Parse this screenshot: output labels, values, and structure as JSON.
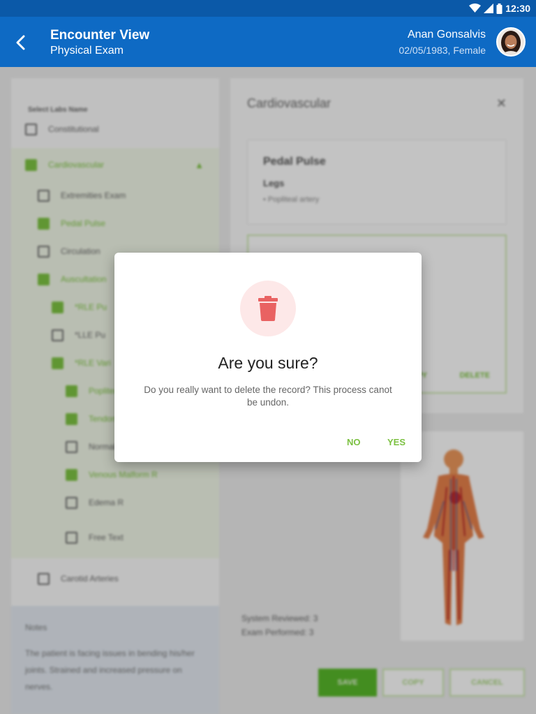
{
  "status_bar": {
    "time": "12:30"
  },
  "header": {
    "title": "Encounter View",
    "subtitle": "Physical Exam",
    "patient_name": "Anan Gonsalvis",
    "patient_meta": "02/05/1983, Female"
  },
  "left_panel": {
    "heading": "Select Labs Name",
    "items": [
      {
        "label": "Constitutional",
        "checked": false
      },
      {
        "label": "Cardiovascular",
        "checked": true
      },
      {
        "label": "Extremities Exam",
        "checked": false
      },
      {
        "label": "Pedal Pulse",
        "checked": true
      },
      {
        "label": "Circulation",
        "checked": false
      },
      {
        "label": "Auscultation",
        "checked": true
      },
      {
        "label": "*RLE Pu",
        "checked": true
      },
      {
        "label": "*LLE Pu",
        "checked": false
      },
      {
        "label": "*RLE Vari",
        "checked": true
      },
      {
        "label": "Popliteal",
        "checked": true
      },
      {
        "label": "Tendon",
        "checked": true
      },
      {
        "label": "Normal",
        "checked": false
      },
      {
        "label": "Venous Malform R",
        "checked": true
      },
      {
        "label": "Edema R",
        "checked": false
      },
      {
        "label": "Free Text",
        "checked": false
      },
      {
        "label": "Carotid Arteries",
        "checked": false
      }
    ],
    "notes_heading": "Notes",
    "notes_text": "The patient is facing issues in bending his/her joints. Strained and increased pressure on nerves."
  },
  "right_panel": {
    "title": "Cardiovascular",
    "card_title": "Pedal Pulse",
    "card_subtitle": "Legs",
    "card_item": "• Popliteal artery",
    "copy_label": "COPY",
    "delete_label": "DELETE",
    "systems_reviewed": "System Reviewed: 3",
    "exam_performed": "Exam Performed: 3"
  },
  "footer": {
    "save_label": "SAVE",
    "copy_label": "COPY",
    "cancel_label": "CANCEL"
  },
  "dialog": {
    "icon": "trash-icon",
    "title": "Are you sure?",
    "message": "Do you really want to delete the record? This process canot be undon.",
    "no_label": "NO",
    "yes_label": "YES"
  },
  "colors": {
    "app_bar": "#0e6ac4",
    "status_bar": "#0b59a8",
    "accent_green": "#7cc142",
    "danger_red": "#e96262"
  }
}
